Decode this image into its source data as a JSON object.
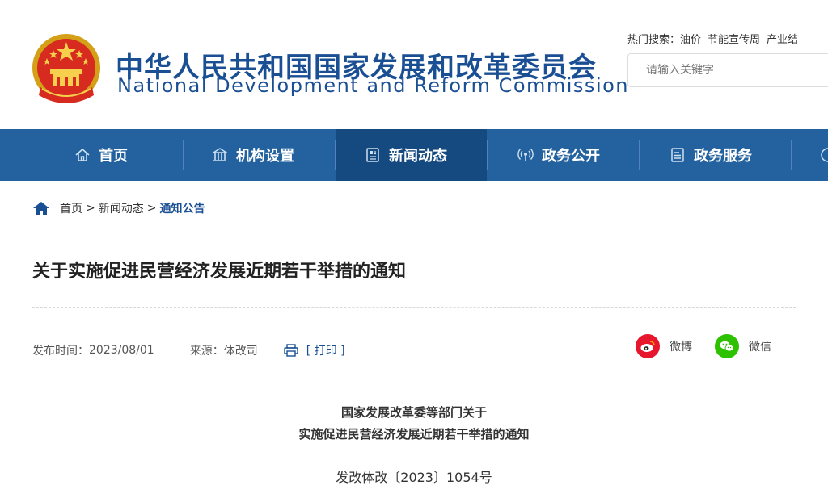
{
  "site": {
    "title_cn": "中华人民共和国国家发展和改革委员会",
    "title_en": "National Development and Reform Commission",
    "emblem": "national-emblem"
  },
  "search": {
    "hot_label": "热门搜索：",
    "hot_terms": [
      "油价",
      "节能宣传周",
      "产业结"
    ],
    "placeholder": "请输入关键字"
  },
  "nav": {
    "items": [
      {
        "label": "首页",
        "icon": "home-icon"
      },
      {
        "label": "机构设置",
        "icon": "building-icon"
      },
      {
        "label": "新闻动态",
        "icon": "news-icon"
      },
      {
        "label": "政务公开",
        "icon": "broadcast-icon"
      },
      {
        "label": "政务服务",
        "icon": "document-icon"
      }
    ],
    "active": "新闻动态"
  },
  "breadcrumb": {
    "home": "首页",
    "level2": "新闻动态",
    "current": "通知公告",
    "separator": ">"
  },
  "article": {
    "title": "关于实施促进民营经济发展近期若干举措的通知",
    "publish_label": "发布时间：",
    "publish_date": "2023/08/01",
    "source_label": "来源：",
    "source": "体改司",
    "print_label": "[ 打印 ]",
    "heading_line1": "国家发展改革委等部门关于",
    "heading_line2": "实施促进民营经济发展近期若干举措的通知",
    "doc_number": "发改体改〔2023〕1054号"
  },
  "share": {
    "weibo": "微博",
    "wechat": "微信"
  },
  "colors": {
    "brand_blue": "#1a4f94",
    "nav_bg": "#23629f",
    "nav_active": "#154a80",
    "weibo_red": "#e6162d",
    "wechat_green": "#2dc100"
  }
}
